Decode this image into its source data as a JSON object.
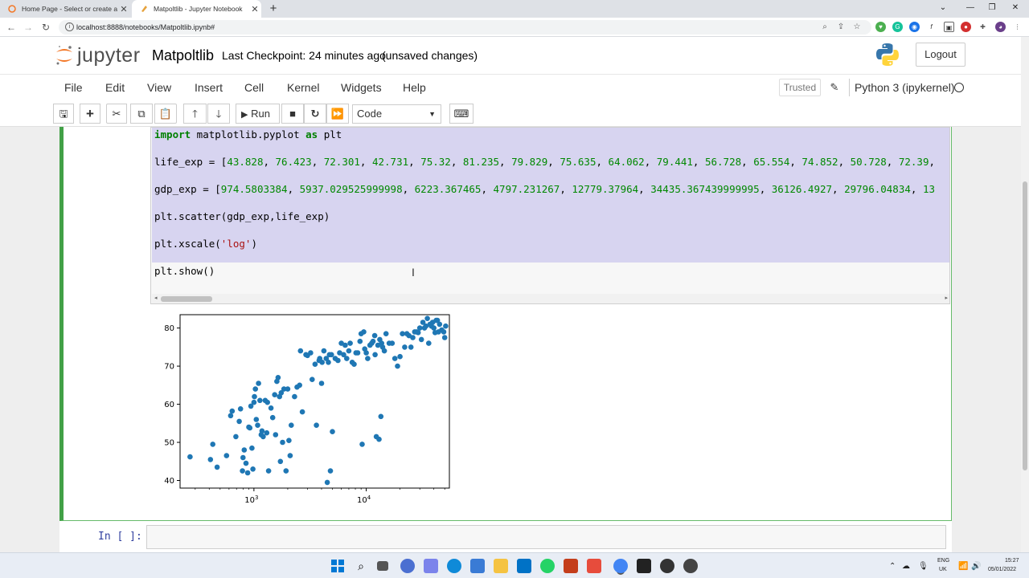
{
  "browser": {
    "tabs": [
      {
        "title": "Home Page - Select or create a n",
        "active": false
      },
      {
        "title": "Matpoltlib - Jupyter Notebook",
        "active": true
      }
    ],
    "url": "localhost:8888/notebooks/Matpoltlib.ipynb#"
  },
  "header": {
    "logo_text": "jupyter",
    "notebook_name": "Matpoltlib",
    "checkpoint": "Last Checkpoint: 24 minutes ago",
    "unsaved": "(unsaved changes)",
    "logout_label": "Logout"
  },
  "menu": {
    "items": [
      "File",
      "Edit",
      "View",
      "Insert",
      "Cell",
      "Kernel",
      "Widgets",
      "Help"
    ],
    "trusted": "Trusted",
    "kernel": "Python 3 (ipykernel)"
  },
  "toolbar": {
    "run_label": "Run",
    "cell_type": "Code"
  },
  "cell": {
    "lines": [
      {
        "parts": [
          {
            "t": "import",
            "c": "kw"
          },
          {
            "t": " matplotlib.pyplot ",
            "c": ""
          },
          {
            "t": "as",
            "c": "kw"
          },
          {
            "t": " plt",
            "c": ""
          }
        ]
      },
      {
        "parts": [
          {
            "t": "life_exp = [",
            "c": ""
          },
          {
            "t": "43.828",
            "c": "num"
          },
          {
            "t": ", ",
            "c": ""
          },
          {
            "t": "76.423",
            "c": "num"
          },
          {
            "t": ", ",
            "c": ""
          },
          {
            "t": "72.301",
            "c": "num"
          },
          {
            "t": ", ",
            "c": ""
          },
          {
            "t": "42.731",
            "c": "num"
          },
          {
            "t": ", ",
            "c": ""
          },
          {
            "t": "75.32",
            "c": "num"
          },
          {
            "t": ", ",
            "c": ""
          },
          {
            "t": "81.235",
            "c": "num"
          },
          {
            "t": ", ",
            "c": ""
          },
          {
            "t": "79.829",
            "c": "num"
          },
          {
            "t": ", ",
            "c": ""
          },
          {
            "t": "75.635",
            "c": "num"
          },
          {
            "t": ", ",
            "c": ""
          },
          {
            "t": "64.062",
            "c": "num"
          },
          {
            "t": ", ",
            "c": ""
          },
          {
            "t": "79.441",
            "c": "num"
          },
          {
            "t": ", ",
            "c": ""
          },
          {
            "t": "56.728",
            "c": "num"
          },
          {
            "t": ", ",
            "c": ""
          },
          {
            "t": "65.554",
            "c": "num"
          },
          {
            "t": ", ",
            "c": ""
          },
          {
            "t": "74.852",
            "c": "num"
          },
          {
            "t": ", ",
            "c": ""
          },
          {
            "t": "50.728",
            "c": "num"
          },
          {
            "t": ", ",
            "c": ""
          },
          {
            "t": "72.39",
            "c": "num"
          },
          {
            "t": ",",
            "c": ""
          }
        ]
      },
      {
        "parts": [
          {
            "t": "gdp_exp = [",
            "c": ""
          },
          {
            "t": "974.5803384",
            "c": "num"
          },
          {
            "t": ", ",
            "c": ""
          },
          {
            "t": "5937.029525999998",
            "c": "num"
          },
          {
            "t": ", ",
            "c": ""
          },
          {
            "t": "6223.367465",
            "c": "num"
          },
          {
            "t": ", ",
            "c": ""
          },
          {
            "t": "4797.231267",
            "c": "num"
          },
          {
            "t": ", ",
            "c": ""
          },
          {
            "t": "12779.37964",
            "c": "num"
          },
          {
            "t": ", ",
            "c": ""
          },
          {
            "t": "34435.367439999995",
            "c": "num"
          },
          {
            "t": ", ",
            "c": ""
          },
          {
            "t": "36126.4927",
            "c": "num"
          },
          {
            "t": ", ",
            "c": ""
          },
          {
            "t": "29796.04834",
            "c": "num"
          },
          {
            "t": ", ",
            "c": ""
          },
          {
            "t": "13",
            "c": "num"
          }
        ]
      },
      {
        "parts": [
          {
            "t": "plt.scatter(gdp_exp,life_exp)",
            "c": ""
          }
        ]
      },
      {
        "parts": [
          {
            "t": "plt.xscale(",
            "c": ""
          },
          {
            "t": "'log'",
            "c": "str"
          },
          {
            "t": ")",
            "c": ""
          }
        ]
      },
      {
        "parts": [
          {
            "t": "plt.show()",
            "c": ""
          }
        ]
      }
    ],
    "next_prompt": "In [ ]:"
  },
  "colors": {
    "scatter": "#1f77b4",
    "selection": "#d7d4f0",
    "cell_border": "#42a047"
  },
  "taskbar": {
    "lang_top": "ENG",
    "lang_bottom": "UK",
    "time": "15:27",
    "date": "05/01/2022"
  },
  "chart_data": {
    "type": "scatter",
    "title": "",
    "xlabel": "",
    "ylabel": "",
    "xscale": "log",
    "xlim": [
      220,
      55000
    ],
    "ylim": [
      38,
      83.5
    ],
    "xticks": [
      {
        "v": 1000,
        "label": "10",
        "exp": "3"
      },
      {
        "v": 10000,
        "label": "10",
        "exp": "4"
      }
    ],
    "yticks": [
      40,
      50,
      60,
      70,
      80
    ],
    "grid": false,
    "series": [
      {
        "points": [
          [
            270,
            46.2
          ],
          [
            410,
            45.5
          ],
          [
            430,
            49.5
          ],
          [
            470,
            43.5
          ],
          [
            570,
            46.5
          ],
          [
            620,
            57
          ],
          [
            640,
            58.2
          ],
          [
            690,
            51.5
          ],
          [
            740,
            55.5
          ],
          [
            760,
            58.8
          ],
          [
            790,
            42.5
          ],
          [
            800,
            46
          ],
          [
            820,
            48
          ],
          [
            850,
            44.5
          ],
          [
            880,
            42
          ],
          [
            900,
            54
          ],
          [
            920,
            53.8
          ],
          [
            940,
            59.5
          ],
          [
            960,
            48.5
          ],
          [
            980,
            43
          ],
          [
            1000,
            60.5
          ],
          [
            1010,
            62
          ],
          [
            1030,
            64
          ],
          [
            1050,
            56
          ],
          [
            1080,
            54.5
          ],
          [
            1100,
            65.5
          ],
          [
            1130,
            61
          ],
          [
            1160,
            52
          ],
          [
            1180,
            53
          ],
          [
            1210,
            51.5
          ],
          [
            1260,
            61
          ],
          [
            1300,
            52.5
          ],
          [
            1320,
            60.5
          ],
          [
            1350,
            42.5
          ],
          [
            1420,
            59
          ],
          [
            1470,
            56.5
          ],
          [
            1530,
            62.5
          ],
          [
            1560,
            52
          ],
          [
            1600,
            66
          ],
          [
            1640,
            67
          ],
          [
            1690,
            62
          ],
          [
            1720,
            45
          ],
          [
            1750,
            63
          ],
          [
            1800,
            50
          ],
          [
            1850,
            64
          ],
          [
            1930,
            42.5
          ],
          [
            2000,
            64
          ],
          [
            2050,
            50.5
          ],
          [
            2100,
            46.5
          ],
          [
            2150,
            54.5
          ],
          [
            2300,
            62
          ],
          [
            2420,
            64.5
          ],
          [
            2550,
            65
          ],
          [
            2600,
            74
          ],
          [
            2700,
            58
          ],
          [
            2900,
            73
          ],
          [
            3000,
            72.8
          ],
          [
            3200,
            73.5
          ],
          [
            3300,
            66.5
          ],
          [
            3500,
            70.5
          ],
          [
            3600,
            54.5
          ],
          [
            3800,
            71.5
          ],
          [
            3850,
            72
          ],
          [
            4000,
            65.5
          ],
          [
            4050,
            71
          ],
          [
            4200,
            74
          ],
          [
            4400,
            72
          ],
          [
            4500,
            39.5
          ],
          [
            4600,
            71
          ],
          [
            4700,
            73
          ],
          [
            4800,
            42.5
          ],
          [
            4900,
            73
          ],
          [
            5000,
            52.8
          ],
          [
            5300,
            72
          ],
          [
            5600,
            71.5
          ],
          [
            5800,
            73.5
          ],
          [
            6000,
            76
          ],
          [
            6300,
            73
          ],
          [
            6500,
            75.5
          ],
          [
            6700,
            72
          ],
          [
            7000,
            74
          ],
          [
            7200,
            76
          ],
          [
            7500,
            71
          ],
          [
            7800,
            70.5
          ],
          [
            8100,
            73.5
          ],
          [
            8400,
            73.5
          ],
          [
            8800,
            76.5
          ],
          [
            9000,
            78.5
          ],
          [
            9200,
            49.5
          ],
          [
            9500,
            79
          ],
          [
            9700,
            74.5
          ],
          [
            10000,
            73.5
          ],
          [
            10300,
            72
          ],
          [
            10800,
            75.5
          ],
          [
            11200,
            76
          ],
          [
            11500,
            76.5
          ],
          [
            11900,
            78
          ],
          [
            12000,
            73
          ],
          [
            12300,
            51.5
          ],
          [
            12700,
            75.5
          ],
          [
            13000,
            50.8
          ],
          [
            13200,
            77
          ],
          [
            13500,
            56.8
          ],
          [
            13700,
            76
          ],
          [
            14000,
            75
          ],
          [
            14500,
            74
          ],
          [
            15000,
            78.5
          ],
          [
            16000,
            76
          ],
          [
            17000,
            76
          ],
          [
            18000,
            72
          ],
          [
            19000,
            70
          ],
          [
            20000,
            72.5
          ],
          [
            21000,
            78.5
          ],
          [
            22000,
            75
          ],
          [
            23000,
            78.5
          ],
          [
            24000,
            78
          ],
          [
            25000,
            75
          ],
          [
            26000,
            77.5
          ],
          [
            27000,
            79
          ],
          [
            28000,
            79
          ],
          [
            29000,
            78.8
          ],
          [
            30000,
            80
          ],
          [
            31000,
            77
          ],
          [
            32000,
            81.5
          ],
          [
            33000,
            80
          ],
          [
            34000,
            80.5
          ],
          [
            35000,
            82.5
          ],
          [
            36000,
            76
          ],
          [
            37000,
            81
          ],
          [
            38000,
            80.5
          ],
          [
            39000,
            81.5
          ],
          [
            40000,
            80
          ],
          [
            41000,
            78.8
          ],
          [
            42000,
            82
          ],
          [
            43000,
            82
          ],
          [
            44000,
            79
          ],
          [
            45000,
            81
          ],
          [
            47000,
            79.5
          ],
          [
            49000,
            79
          ],
          [
            51000,
            80.5
          ],
          [
            50000,
            77.5
          ]
        ]
      }
    ]
  }
}
